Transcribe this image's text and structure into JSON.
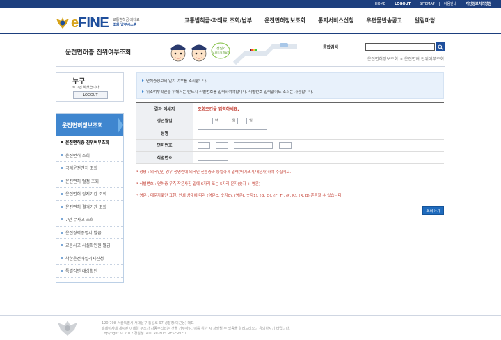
{
  "util_bar": {
    "links": [
      {
        "label": "HOME",
        "bold": false
      },
      {
        "label": "LOGOUT",
        "bold": true
      },
      {
        "label": "SITEMAP",
        "bold": false
      },
      {
        "label": "이용안내",
        "bold": false
      },
      {
        "label": "개인정보처리방침",
        "bold": true
      }
    ]
  },
  "brand": {
    "logo_e": "e",
    "logo_rest": "FINE",
    "sub1": "교통범칙금·과태료",
    "sub2": "조회·납부시스템"
  },
  "gnb": {
    "items": [
      "교통범칙금·과태료 조회/납부",
      "운전면허정보조회",
      "통지서비스신청",
      "우편물반송공고",
      "알림마당"
    ]
  },
  "title_band": {
    "page_title": "운전면허증 진위여부조회",
    "illustration_bubble": "정말?도와드릴까요?",
    "search_label": "통합검색",
    "search_value": "",
    "breadcrumb": "운전면허정보조회 > 운전면허 진위여부조회"
  },
  "login": {
    "who": "누구",
    "message": "로그인 하셨습니다.",
    "logout_label": "LOGOUT"
  },
  "snb": {
    "title": "운전면허정보조회",
    "items": [
      {
        "label": "운전면허증 진위여부조회",
        "active": true
      },
      {
        "label": "운전면허 조회",
        "active": false
      },
      {
        "label": "국제운전면허 조회",
        "active": false
      },
      {
        "label": "운전면허 벌점 조회",
        "active": false
      },
      {
        "label": "운전면허 정지기간 조회",
        "active": false
      },
      {
        "label": "운전면허 결격기간 조회",
        "active": false
      },
      {
        "label": "7년 무사고 조회",
        "active": false
      },
      {
        "label": "운전경력증명서 발급",
        "active": false
      },
      {
        "label": "교통사고 사실확인원 발급",
        "active": false
      },
      {
        "label": "착한운전마일리지신청",
        "active": false
      },
      {
        "label": "특별감면 대상확인",
        "active": false
      }
    ]
  },
  "notice": {
    "lines": [
      "면허증정보의 일치 여부를 조회합니다.",
      "위조여부확인을 위해서는 반드시 식별번호를 입력하여야합니다. 식별번호 입력없이도 조회는 가능합니다."
    ]
  },
  "form": {
    "result_label": "결과 메세지",
    "result_value": "조회조건을 입력하세요.",
    "birth_label": "생년월일",
    "unit_year": "년",
    "unit_month": "월",
    "unit_day": "일",
    "name_label": "성명",
    "license_label": "면허번호",
    "id_label": "식별번호",
    "submit_label": "조회하기"
  },
  "guides": [
    "* 성명 : 외국인인 경우 성명란에 외국인 신분증과 동일하게 입력(띄어쓰기,대문자)하여 주십시오.",
    "* 식별번호 : 면허증 우측 작은사진 밑에 6자리 또는 5자리 문자(숫자 + 영문)",
    "* 영문 : 대문자로만 표현, 인쇄 상태에 따라 (영문O, 숫자0), (영문I, 숫자1), (G, Q), (F, T), (P, R), (R, B) 혼동할 수 있습니다."
  ],
  "footer": {
    "lines": [
      "120-708 서울특별시 서대문구 통일로 97 경찰청(미근동) 대표",
      "홈페이지에 게시된 이메일 주소가 자동수집되는 것을 거부하며, 이를 위반 시 처벌될 수 있음을 알려드리오니 유의하시기 바랍니다.",
      "Copyright © 2012 경찰청. ALL RIGHTS RESERVED"
    ]
  },
  "colors": {
    "navy": "#1d3f7e",
    "accent_blue": "#3f86cf",
    "alert_red": "#c23a2e"
  }
}
